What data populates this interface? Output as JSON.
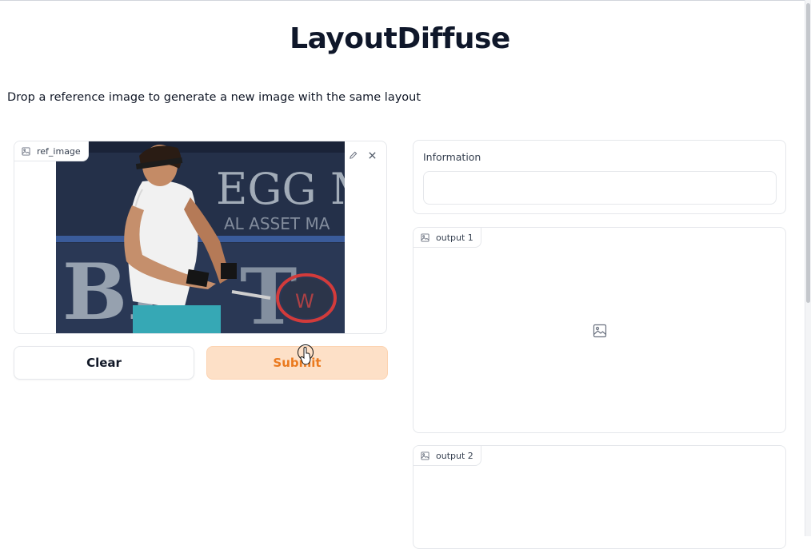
{
  "page": {
    "title": "LayoutDiffuse",
    "description": "Drop a reference image to generate a new image with the same layout"
  },
  "ref_image": {
    "label": "ref_image",
    "icon": "image-icon",
    "tools": [
      "edit-icon",
      "close-icon"
    ]
  },
  "buttons": {
    "clear": "Clear",
    "submit": "Submit"
  },
  "information": {
    "label": "Information",
    "value": ""
  },
  "outputs": [
    {
      "label": "output 1",
      "icon": "image-icon"
    },
    {
      "label": "output 2",
      "icon": "image-icon"
    }
  ],
  "colors": {
    "submit_bg": "#fde0c7",
    "submit_text": "#ea7a1f",
    "border": "#e5e7eb"
  }
}
